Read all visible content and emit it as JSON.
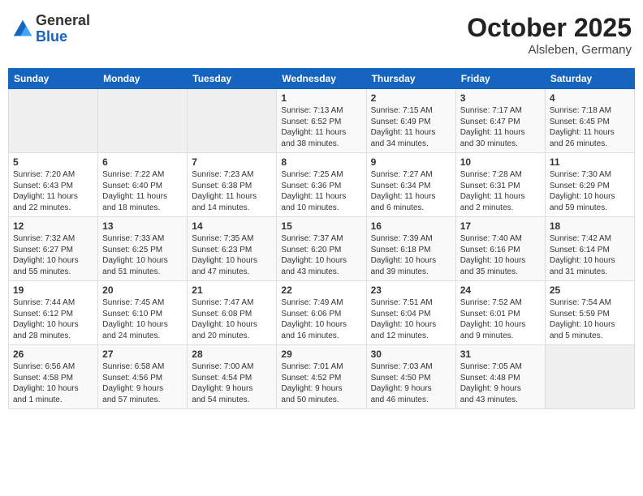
{
  "logo": {
    "general": "General",
    "blue": "Blue"
  },
  "header": {
    "month": "October 2025",
    "location": "Alsleben, Germany"
  },
  "weekdays": [
    "Sunday",
    "Monday",
    "Tuesday",
    "Wednesday",
    "Thursday",
    "Friday",
    "Saturday"
  ],
  "weeks": [
    [
      {
        "day": "",
        "info": ""
      },
      {
        "day": "",
        "info": ""
      },
      {
        "day": "",
        "info": ""
      },
      {
        "day": "1",
        "info": "Sunrise: 7:13 AM\nSunset: 6:52 PM\nDaylight: 11 hours\nand 38 minutes."
      },
      {
        "day": "2",
        "info": "Sunrise: 7:15 AM\nSunset: 6:49 PM\nDaylight: 11 hours\nand 34 minutes."
      },
      {
        "day": "3",
        "info": "Sunrise: 7:17 AM\nSunset: 6:47 PM\nDaylight: 11 hours\nand 30 minutes."
      },
      {
        "day": "4",
        "info": "Sunrise: 7:18 AM\nSunset: 6:45 PM\nDaylight: 11 hours\nand 26 minutes."
      }
    ],
    [
      {
        "day": "5",
        "info": "Sunrise: 7:20 AM\nSunset: 6:43 PM\nDaylight: 11 hours\nand 22 minutes."
      },
      {
        "day": "6",
        "info": "Sunrise: 7:22 AM\nSunset: 6:40 PM\nDaylight: 11 hours\nand 18 minutes."
      },
      {
        "day": "7",
        "info": "Sunrise: 7:23 AM\nSunset: 6:38 PM\nDaylight: 11 hours\nand 14 minutes."
      },
      {
        "day": "8",
        "info": "Sunrise: 7:25 AM\nSunset: 6:36 PM\nDaylight: 11 hours\nand 10 minutes."
      },
      {
        "day": "9",
        "info": "Sunrise: 7:27 AM\nSunset: 6:34 PM\nDaylight: 11 hours\nand 6 minutes."
      },
      {
        "day": "10",
        "info": "Sunrise: 7:28 AM\nSunset: 6:31 PM\nDaylight: 11 hours\nand 2 minutes."
      },
      {
        "day": "11",
        "info": "Sunrise: 7:30 AM\nSunset: 6:29 PM\nDaylight: 10 hours\nand 59 minutes."
      }
    ],
    [
      {
        "day": "12",
        "info": "Sunrise: 7:32 AM\nSunset: 6:27 PM\nDaylight: 10 hours\nand 55 minutes."
      },
      {
        "day": "13",
        "info": "Sunrise: 7:33 AM\nSunset: 6:25 PM\nDaylight: 10 hours\nand 51 minutes."
      },
      {
        "day": "14",
        "info": "Sunrise: 7:35 AM\nSunset: 6:23 PM\nDaylight: 10 hours\nand 47 minutes."
      },
      {
        "day": "15",
        "info": "Sunrise: 7:37 AM\nSunset: 6:20 PM\nDaylight: 10 hours\nand 43 minutes."
      },
      {
        "day": "16",
        "info": "Sunrise: 7:39 AM\nSunset: 6:18 PM\nDaylight: 10 hours\nand 39 minutes."
      },
      {
        "day": "17",
        "info": "Sunrise: 7:40 AM\nSunset: 6:16 PM\nDaylight: 10 hours\nand 35 minutes."
      },
      {
        "day": "18",
        "info": "Sunrise: 7:42 AM\nSunset: 6:14 PM\nDaylight: 10 hours\nand 31 minutes."
      }
    ],
    [
      {
        "day": "19",
        "info": "Sunrise: 7:44 AM\nSunset: 6:12 PM\nDaylight: 10 hours\nand 28 minutes."
      },
      {
        "day": "20",
        "info": "Sunrise: 7:45 AM\nSunset: 6:10 PM\nDaylight: 10 hours\nand 24 minutes."
      },
      {
        "day": "21",
        "info": "Sunrise: 7:47 AM\nSunset: 6:08 PM\nDaylight: 10 hours\nand 20 minutes."
      },
      {
        "day": "22",
        "info": "Sunrise: 7:49 AM\nSunset: 6:06 PM\nDaylight: 10 hours\nand 16 minutes."
      },
      {
        "day": "23",
        "info": "Sunrise: 7:51 AM\nSunset: 6:04 PM\nDaylight: 10 hours\nand 12 minutes."
      },
      {
        "day": "24",
        "info": "Sunrise: 7:52 AM\nSunset: 6:01 PM\nDaylight: 10 hours\nand 9 minutes."
      },
      {
        "day": "25",
        "info": "Sunrise: 7:54 AM\nSunset: 5:59 PM\nDaylight: 10 hours\nand 5 minutes."
      }
    ],
    [
      {
        "day": "26",
        "info": "Sunrise: 6:56 AM\nSunset: 4:58 PM\nDaylight: 10 hours\nand 1 minute."
      },
      {
        "day": "27",
        "info": "Sunrise: 6:58 AM\nSunset: 4:56 PM\nDaylight: 9 hours\nand 57 minutes."
      },
      {
        "day": "28",
        "info": "Sunrise: 7:00 AM\nSunset: 4:54 PM\nDaylight: 9 hours\nand 54 minutes."
      },
      {
        "day": "29",
        "info": "Sunrise: 7:01 AM\nSunset: 4:52 PM\nDaylight: 9 hours\nand 50 minutes."
      },
      {
        "day": "30",
        "info": "Sunrise: 7:03 AM\nSunset: 4:50 PM\nDaylight: 9 hours\nand 46 minutes."
      },
      {
        "day": "31",
        "info": "Sunrise: 7:05 AM\nSunset: 4:48 PM\nDaylight: 9 hours\nand 43 minutes."
      },
      {
        "day": "",
        "info": ""
      }
    ]
  ]
}
